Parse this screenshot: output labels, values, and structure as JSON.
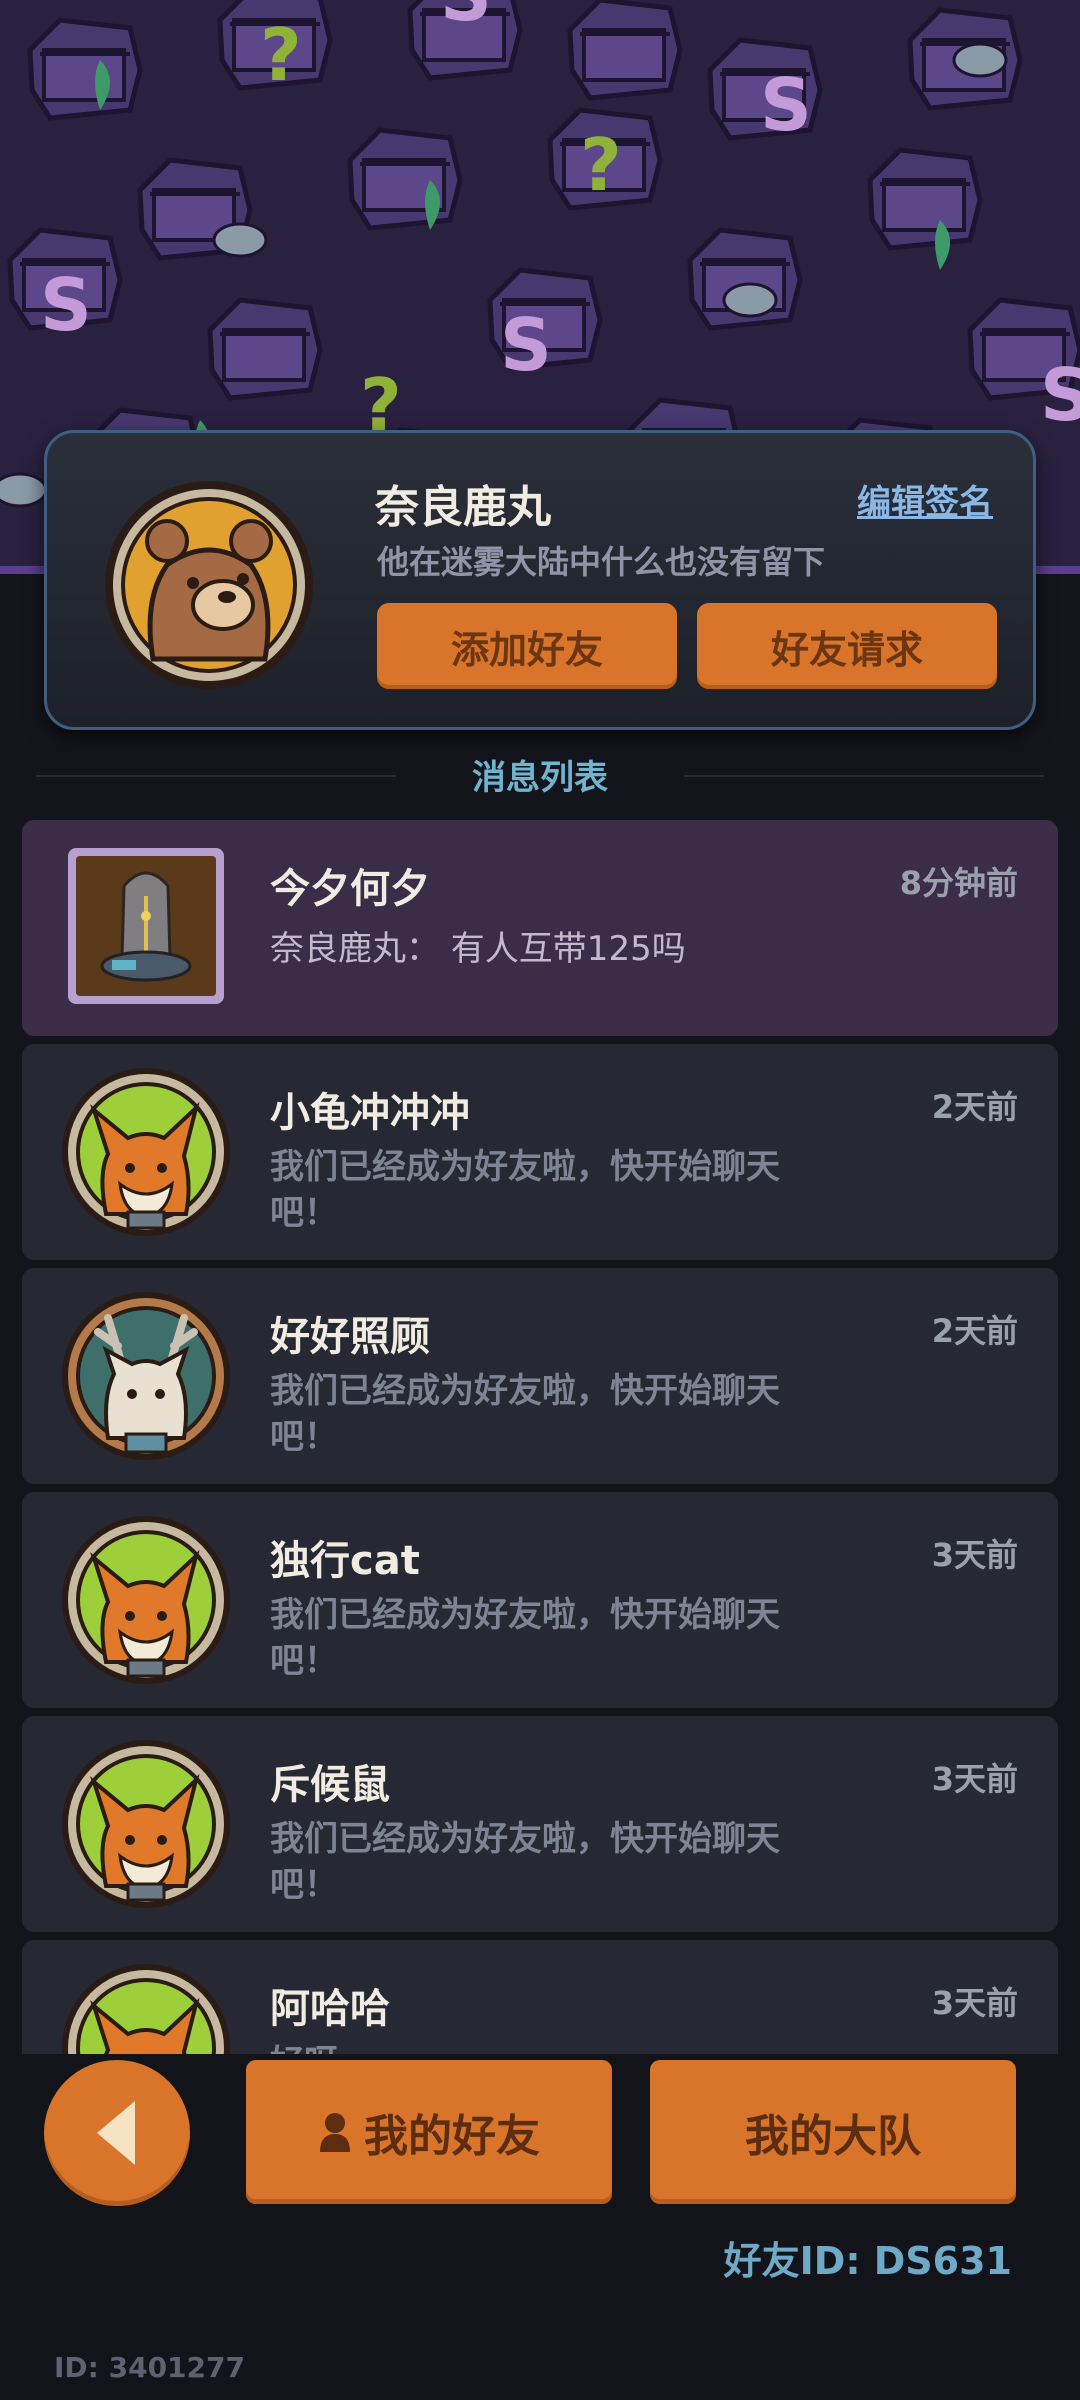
{
  "profile": {
    "name": "奈良鹿丸",
    "signature": "他在迷雾大陆中什么也没有留下",
    "edit_signature": "编辑签名",
    "add_friend": "添加好友",
    "friend_requests": "好友请求"
  },
  "messages": {
    "section_title": "消息列表",
    "items": [
      {
        "name": "今夕何夕",
        "time": "8分钟前",
        "text": "奈良鹿丸：  有人互带125吗",
        "avatar": "lamp-item-icon"
      },
      {
        "name": "小龟冲冲冲",
        "time": "2天前",
        "text": "我们已经成为好友啦，快开始聊天吧！",
        "avatar": "fox-avatar-icon"
      },
      {
        "name": "好好照顾",
        "time": "2天前",
        "text": "我们已经成为好友啦，快开始聊天吧！",
        "avatar": "deer-cat-avatar-icon"
      },
      {
        "name": "独行cat",
        "time": "3天前",
        "text": "我们已经成为好友啦，快开始聊天吧！",
        "avatar": "fox-avatar-icon"
      },
      {
        "name": "斥候鼠",
        "time": "3天前",
        "text": "我们已经成为好友啦，快开始聊天吧！",
        "avatar": "fox-avatar-icon"
      },
      {
        "name": "阿哈哈",
        "time": "3天前",
        "text": "好呀",
        "avatar": "fox-avatar-icon"
      }
    ]
  },
  "bottom": {
    "my_friends": "我的好友",
    "my_team": "我的大队",
    "friend_id": "好友ID: DS631",
    "user_id": "ID: 3401277"
  },
  "colors": {
    "accent_orange": "#d8752a",
    "banner_purple": "#2a2040",
    "active_row": "#3b2d48",
    "row_bg": "#262833",
    "link_blue": "#8ab8e6"
  }
}
